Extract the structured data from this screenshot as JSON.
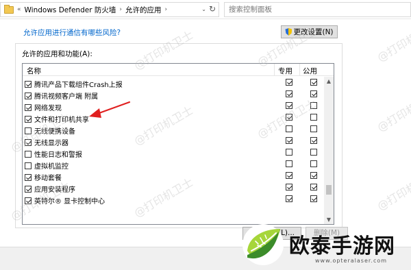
{
  "address_bar": {
    "breadcrumb_root": "«",
    "breadcrumb_1": "Windows Defender 防火墙",
    "breadcrumb_2": "允许的应用",
    "dropdown_glyph": "⌄",
    "refresh_glyph": "↻",
    "search_placeholder": "搜索控制面板"
  },
  "content": {
    "risk_link": "允许应用进行通信有哪些风险?",
    "change_settings_label": "更改设置(N)",
    "group_label": "允许的应用和功能(A):",
    "columns": {
      "name": "名称",
      "private": "专用",
      "public": "公用"
    },
    "rows": [
      {
        "enabled": true,
        "name": "腾讯产品下载组件Crash上报",
        "private": true,
        "public": true
      },
      {
        "enabled": true,
        "name": "腾讯视频客户端 附属",
        "private": true,
        "public": true
      },
      {
        "enabled": true,
        "name": "网络发现",
        "private": true,
        "public": false
      },
      {
        "enabled": true,
        "name": "文件和打印机共享",
        "private": true,
        "public": false
      },
      {
        "enabled": false,
        "name": "无线便携设备",
        "private": false,
        "public": false
      },
      {
        "enabled": true,
        "name": "无线显示器",
        "private": true,
        "public": true
      },
      {
        "enabled": false,
        "name": "性能日志和警报",
        "private": false,
        "public": false
      },
      {
        "enabled": false,
        "name": "虚拟机监控",
        "private": false,
        "public": false
      },
      {
        "enabled": true,
        "name": "移动套餐",
        "private": true,
        "public": true
      },
      {
        "enabled": true,
        "name": "应用安装程序",
        "private": true,
        "public": true
      },
      {
        "enabled": true,
        "name": "英特尔® 显卡控制中心",
        "private": true,
        "public": true
      }
    ],
    "details_label": "详细信息(L)...",
    "delete_label": "删除(M)"
  },
  "watermark_text": "@打印机卫士",
  "logo": {
    "name": "欧泰手游网",
    "url": "www.opteralaser.com"
  },
  "colors": {
    "link": "#0066cc",
    "arrow": "#e02020",
    "logo_green_light": "#a6d63a",
    "logo_green_dark": "#3c8c2a"
  }
}
